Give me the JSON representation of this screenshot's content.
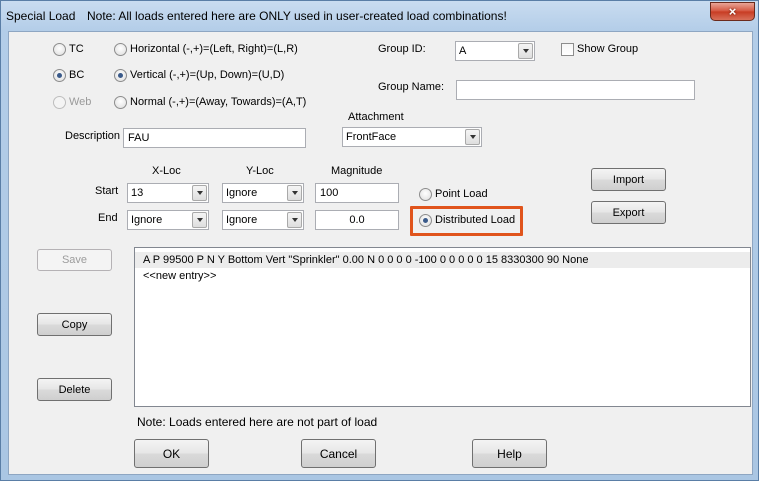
{
  "window": {
    "title": "Special Load",
    "note": "Note: All loads entered here are ONLY used in user-created load combinations!",
    "close_glyph": "×"
  },
  "options": {
    "tc": "TC",
    "bc": "BC",
    "web": "Web",
    "horizontal": "Horizontal (-,+)=(Left, Right)=(L,R)",
    "vertical": "Vertical (-,+)=(Up, Down)=(U,D)",
    "normal": "Normal (-,+)=(Away, Towards)=(A,T)"
  },
  "group": {
    "id_label": "Group ID:",
    "id_value": "A",
    "show_group": "Show Group",
    "name_label": "Group Name:",
    "name_value": ""
  },
  "attachment": {
    "label": "Attachment",
    "value": "FrontFace"
  },
  "description": {
    "label": "Description",
    "value": "FAU"
  },
  "grid": {
    "col_xloc": "X-Loc",
    "col_yloc": "Y-Loc",
    "col_magnitude": "Magnitude",
    "row_start": "Start",
    "row_end": "End",
    "start_x": "13",
    "start_y": "Ignore",
    "start_mag": "100",
    "end_x": "Ignore",
    "end_y": "Ignore",
    "end_mag": "0.0"
  },
  "load_type": {
    "point": "Point Load",
    "distributed": "Distributed Load"
  },
  "buttons": {
    "import": "Import",
    "export": "Export",
    "save": "Save",
    "copy": "Copy",
    "delete": "Delete",
    "ok": "OK",
    "cancel": "Cancel",
    "help": "Help"
  },
  "list": {
    "items": [
      "A P 99500 P N Y Bottom Vert \"Sprinkler\" 0.00 N 0 0 0 0 -100 0 0 0 0 0 15 8330300 90 None",
      "<<new entry>>"
    ]
  },
  "footer_note": "Note: Loads entered here are not part of load",
  "colors": {
    "highlight": "#e0541c",
    "close": "#c73b22"
  }
}
